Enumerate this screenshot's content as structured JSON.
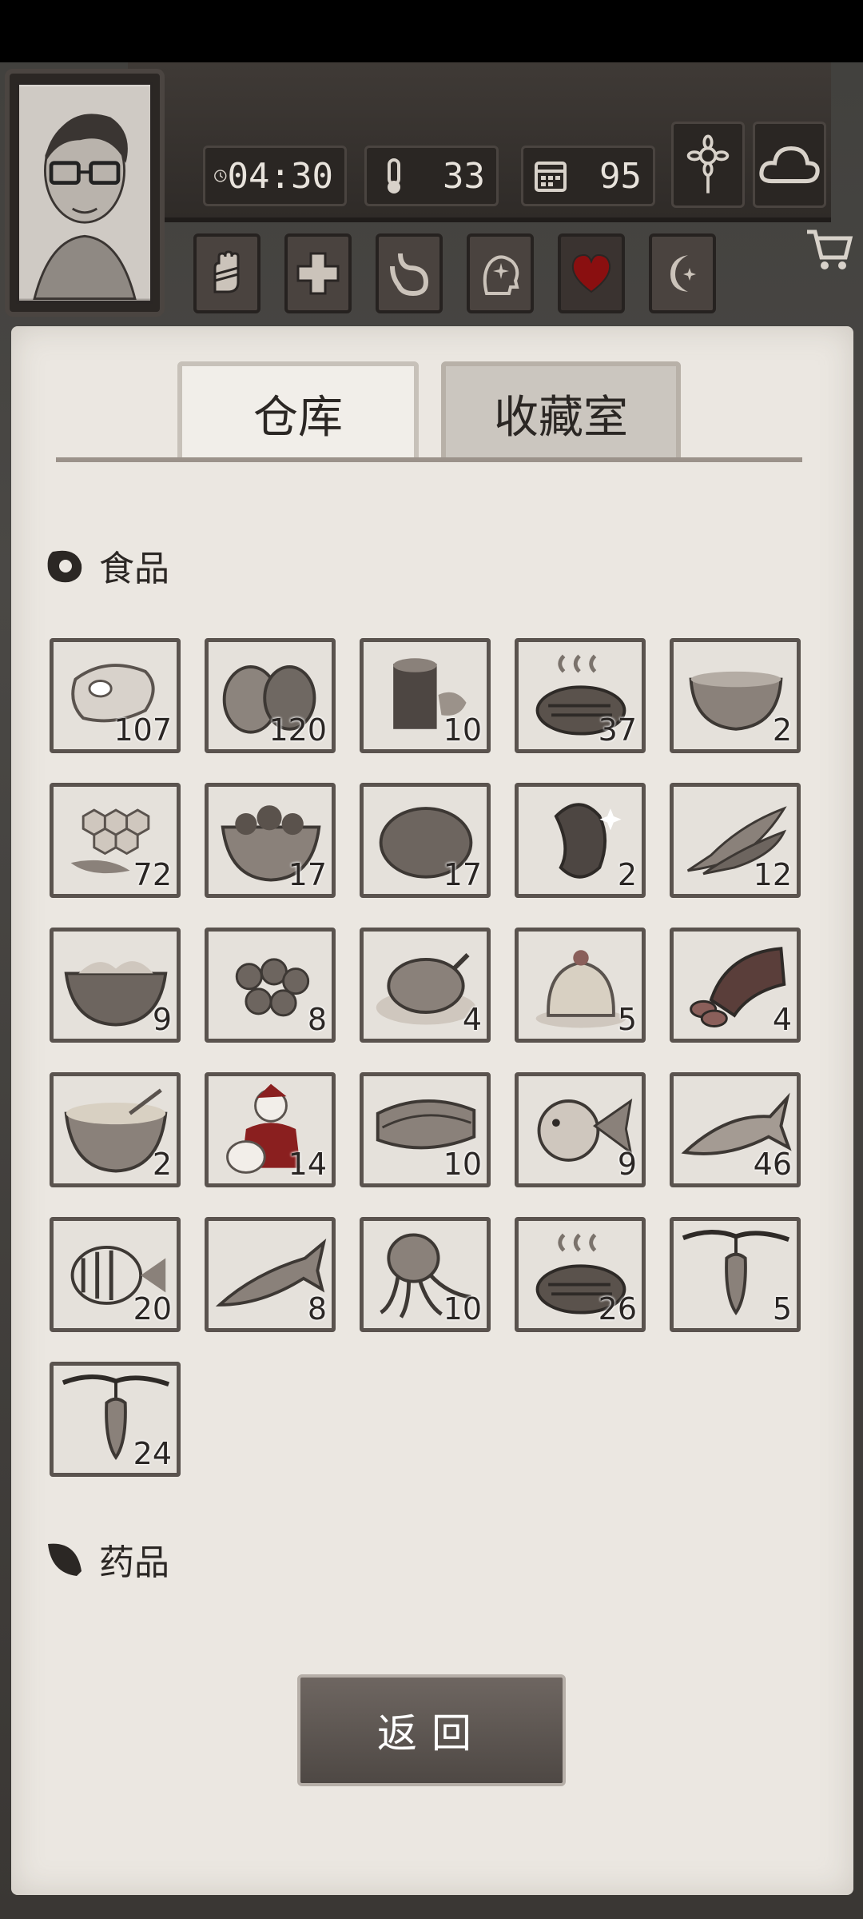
{
  "hud": {
    "time": "04:30",
    "temperature": "33",
    "day": "95"
  },
  "tabs": [
    {
      "label": "仓库",
      "active": true
    },
    {
      "label": "收藏室",
      "active": false
    }
  ],
  "sections": {
    "food": "食品",
    "medicine": "药品"
  },
  "items": [
    {
      "name": "raw-meat-icon",
      "count": "107"
    },
    {
      "name": "coconut-icon",
      "count": "120"
    },
    {
      "name": "canned-food-icon",
      "count": "10"
    },
    {
      "name": "grilled-steak-icon",
      "count": "37"
    },
    {
      "name": "soup-bowl-icon",
      "count": "2"
    },
    {
      "name": "honeycomb-icon",
      "count": "72"
    },
    {
      "name": "fruit-bowl-icon",
      "count": "17"
    },
    {
      "name": "potato-icon",
      "count": "17"
    },
    {
      "name": "bean-icon",
      "count": "2"
    },
    {
      "name": "dried-fish-icon",
      "count": "12"
    },
    {
      "name": "salad-bowl-icon",
      "count": "9"
    },
    {
      "name": "nuts-icon",
      "count": "8"
    },
    {
      "name": "roast-chicken-icon",
      "count": "4"
    },
    {
      "name": "pudding-icon",
      "count": "5"
    },
    {
      "name": "sausage-icon",
      "count": "4"
    },
    {
      "name": "porridge-icon",
      "count": "2"
    },
    {
      "name": "santa-gift-icon",
      "count": "14"
    },
    {
      "name": "sea-cucumber-icon",
      "count": "10"
    },
    {
      "name": "pufferfish-icon",
      "count": "9"
    },
    {
      "name": "salmon-icon",
      "count": "46"
    },
    {
      "name": "butterflyfish-icon",
      "count": "20"
    },
    {
      "name": "trout-icon",
      "count": "8"
    },
    {
      "name": "squid-icon",
      "count": "10"
    },
    {
      "name": "grilled-steak-icon",
      "count": "26"
    },
    {
      "name": "hanging-fruit-icon",
      "count": "5"
    },
    {
      "name": "hanging-fruit-icon",
      "count": "24"
    }
  ],
  "back_button": "返回"
}
